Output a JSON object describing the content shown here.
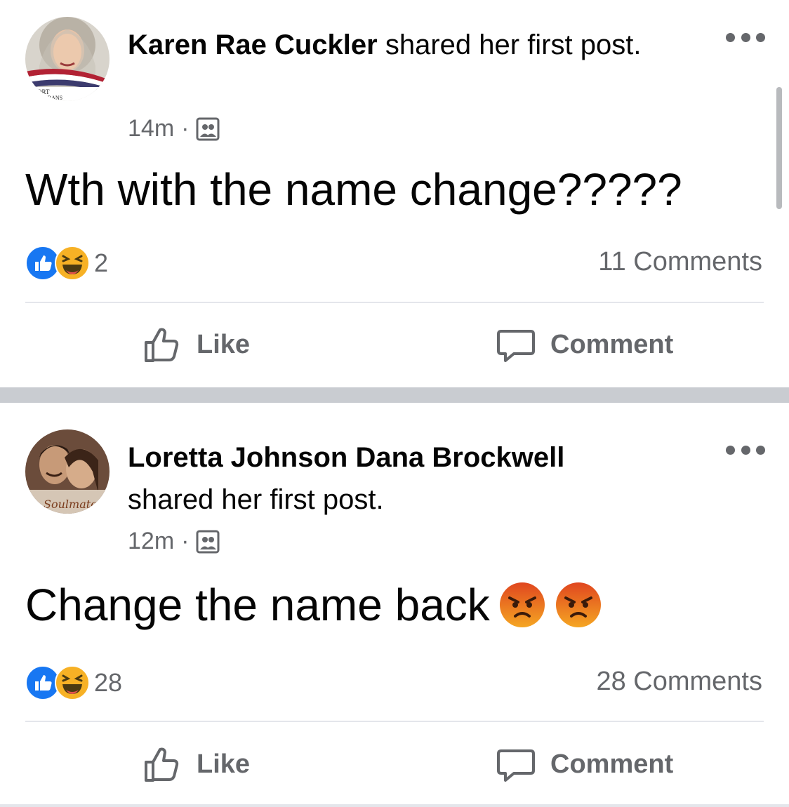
{
  "posts": [
    {
      "author": "Karen Rae Cuckler",
      "action_text": " shared her first post.",
      "timestamp": "14m",
      "separator": "·",
      "audience_icon": "group-icon",
      "body": "Wth with the name change?????",
      "body_emoji": [],
      "reaction_icons": [
        "like-icon",
        "haha-icon"
      ],
      "reaction_count": "2",
      "comments_label": "11 Comments",
      "avatar_text": [
        "PORT",
        "TERANS"
      ],
      "buttons": {
        "like": "Like",
        "comment": "Comment"
      }
    },
    {
      "author": "Loretta Johnson Dana Brockwell",
      "action_text": "shared her first post.",
      "timestamp": "12m",
      "separator": "·",
      "audience_icon": "group-icon",
      "body": "Change the name back",
      "body_emoji": [
        "angry-face-emoji",
        "angry-face-emoji"
      ],
      "reaction_icons": [
        "like-icon",
        "haha-icon"
      ],
      "reaction_count": "28",
      "comments_label": "28 Comments",
      "avatar_text": [
        "Soulmates"
      ],
      "buttons": {
        "like": "Like",
        "comment": "Comment"
      }
    }
  ],
  "colors": {
    "like_blue": "#1877f2",
    "haha_yellow": "#f7b125",
    "angry_orange": "#e9710f",
    "secondary_text": "#65676b",
    "separator_band": "#c9ccd1"
  }
}
